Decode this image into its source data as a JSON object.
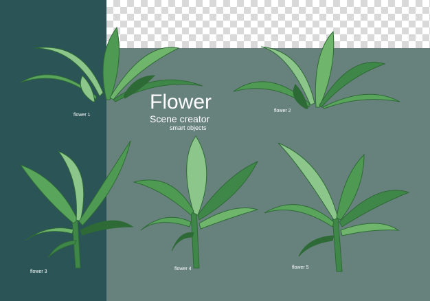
{
  "title": "Flower",
  "subtitle": "Scene creator",
  "tagline": "smart objects",
  "captions": [
    "flower 1",
    "flower 2",
    "flower 3",
    "flower 4",
    "flower 5"
  ],
  "colors": {
    "dark_panel": "#2a5456",
    "gray_panel": "#67817d",
    "leaf_dark": "#2e6a36",
    "leaf_mid": "#4f9a52",
    "leaf_light": "#8cc68a",
    "text": "#ffffff"
  },
  "icons": [
    "plant-illustration"
  ]
}
